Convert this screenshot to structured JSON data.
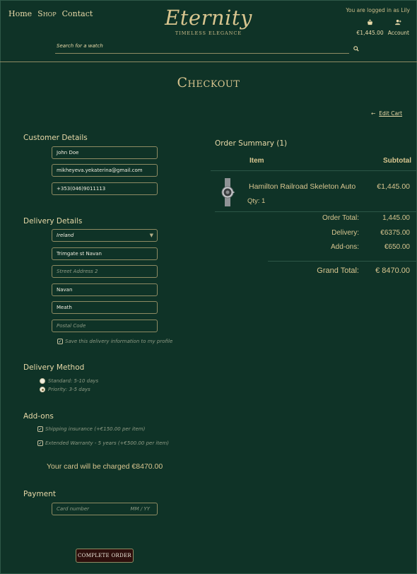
{
  "header": {
    "nav": [
      "Home",
      "Shop",
      "Contact"
    ],
    "brand": "Eternity",
    "tagline": "TIMELESS   ELEGANCE",
    "login_status": "You are logged in as Lily",
    "cart_total": "€1,445.00",
    "account_label": "Account",
    "search_placeholder": "Search for a watch"
  },
  "page_title": "Checkout",
  "edit_cart": "Edit Cart",
  "customer": {
    "title": "Customer Details",
    "name": "John Doe",
    "email": "mikheyeva.yekaterina@gmail.com",
    "phone": "+353(046)9011113"
  },
  "delivery": {
    "title": "Delivery Details",
    "country": "Ireland",
    "street1": "Trimgate st Navan",
    "street2_placeholder": "Street Address 2",
    "town": "Navan",
    "county": "Meath",
    "postcode_placeholder": "Postal Code",
    "save_label": "Save this delivery information to my profile",
    "save_checked": true
  },
  "delivery_method": {
    "title": "Delivery Method",
    "options": [
      {
        "label": "Standard: 5-10 days",
        "selected": false
      },
      {
        "label": "Priority: 3-5 days",
        "selected": true
      }
    ]
  },
  "addons": {
    "title": "Add-ons",
    "items": [
      {
        "label": "Shipping insurance (+€150.00 per item)",
        "checked": true
      },
      {
        "label": "Extended Warranty - 5 years (+€500.00 per item)",
        "checked": true
      }
    ]
  },
  "charge_text": "Your card will be charged €8470.00",
  "payment": {
    "title": "Payment",
    "card_placeholder": "Card number",
    "expiry_placeholder": "MM / YY"
  },
  "complete_button": "COMPLETE ORDER",
  "summary": {
    "title": "Order Summary (1)",
    "col_item": "Item",
    "col_subtotal": "Subtotal",
    "product": "Hamilton Railroad Skeleton Auto",
    "qty": "Qty: 1",
    "price": "€1,445.00",
    "totals": [
      {
        "label": "Order Total:",
        "value": "1,445.00"
      },
      {
        "label": "Delivery:",
        "value": "€6375.00"
      },
      {
        "label": "Add-ons:",
        "value": "€650.00"
      }
    ],
    "grand_label": "Grand Total:",
    "grand_value": "€ 8470.00"
  },
  "colors": {
    "background": "#0f3327",
    "gold": "#d8c58f",
    "button": "#2e0f0c"
  }
}
